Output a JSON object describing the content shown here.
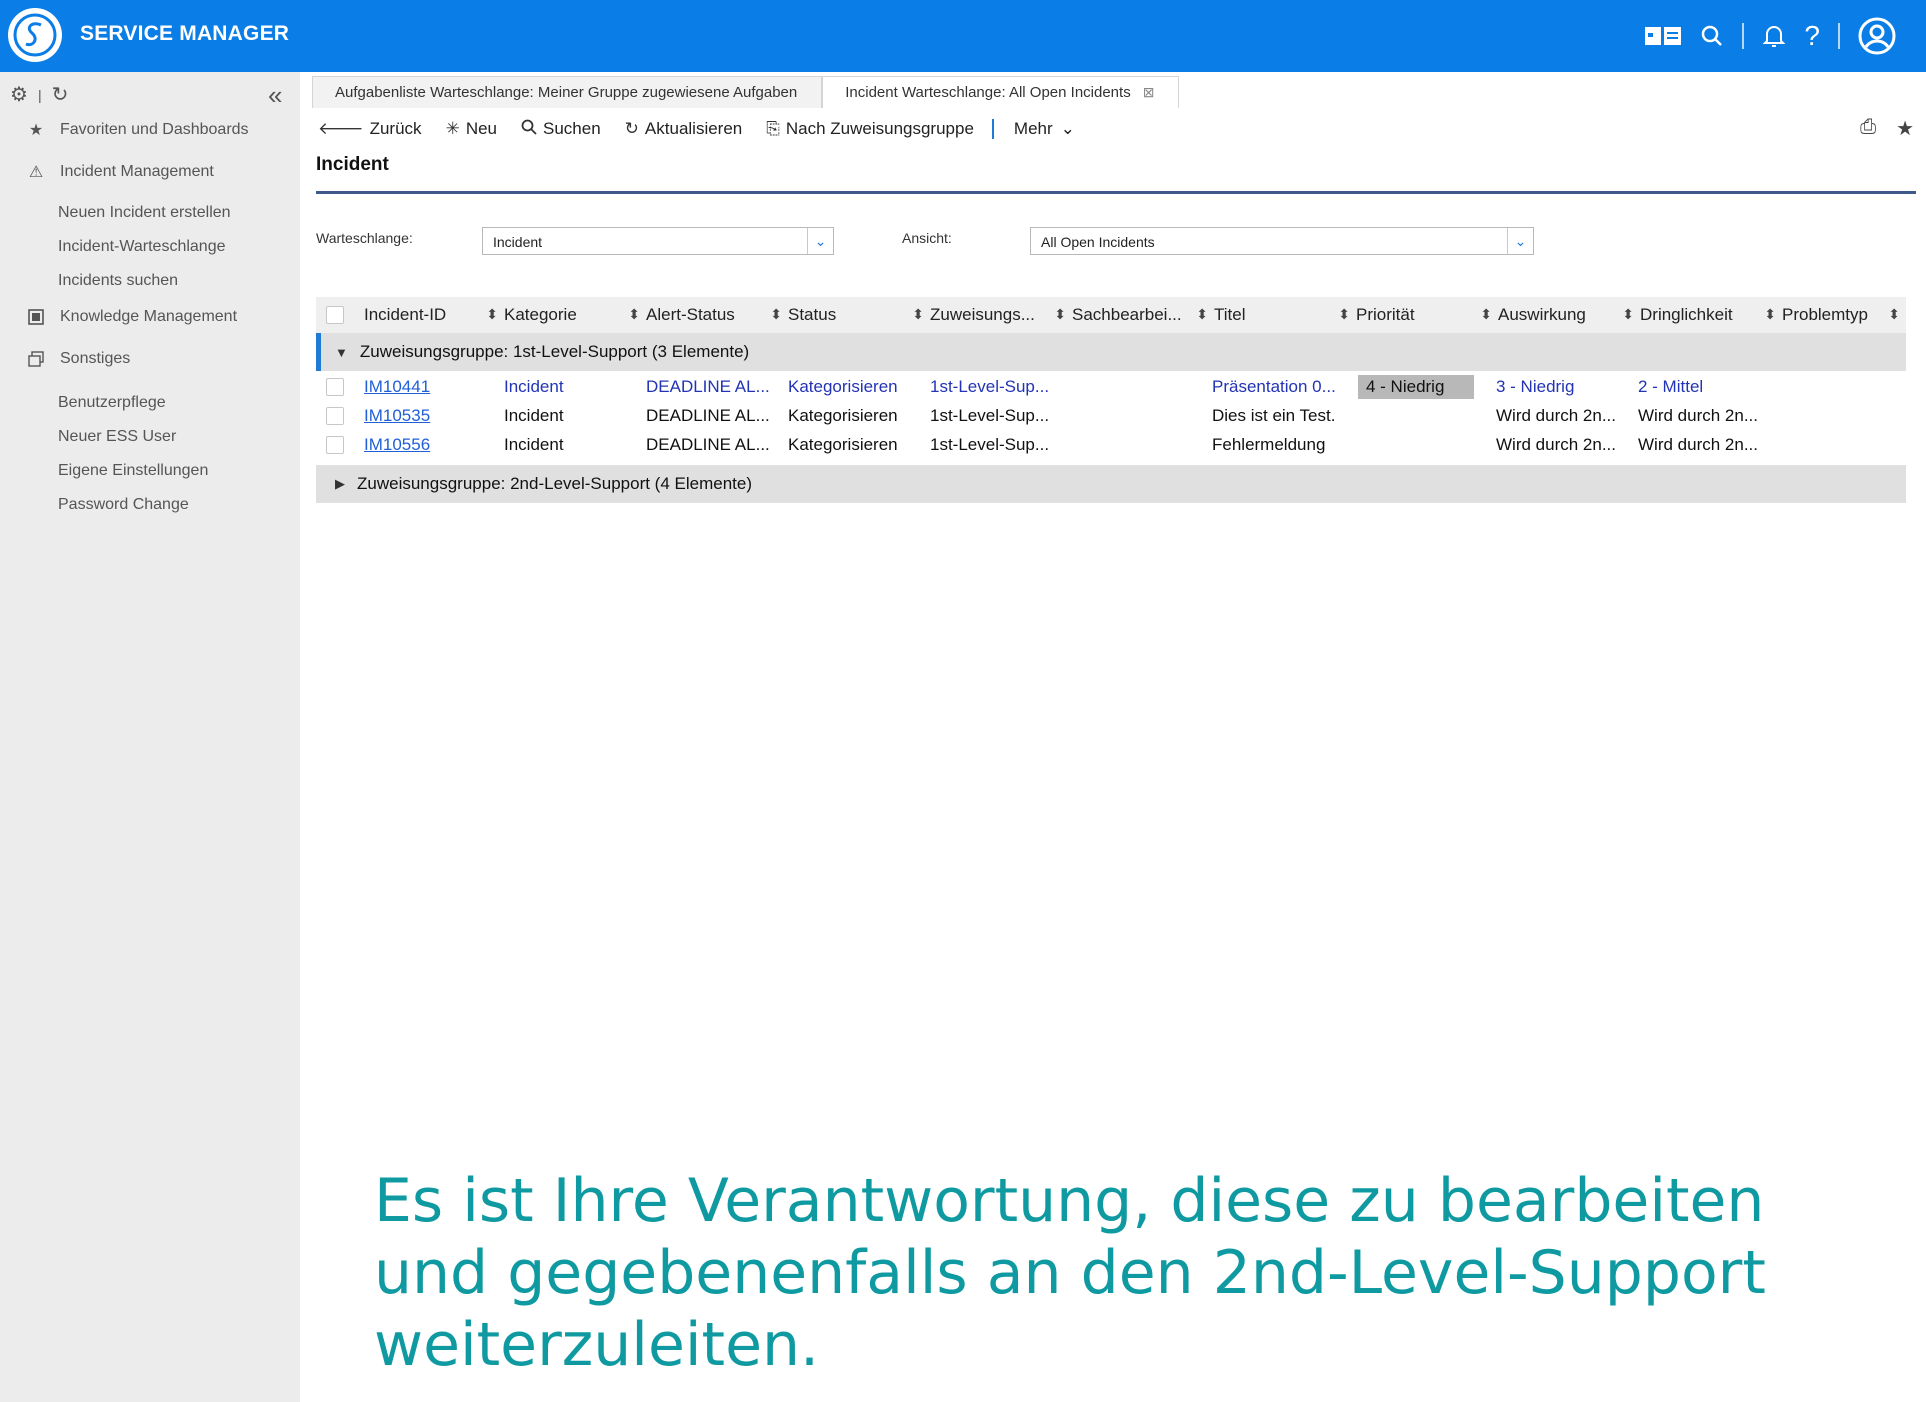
{
  "app": {
    "brand": "SERVICE MANAGER"
  },
  "sidebar": {
    "items": [
      {
        "label": "Favoriten und Dashboards",
        "icon": "star-icon"
      },
      {
        "label": "Incident Management",
        "icon": "warning-icon"
      },
      {
        "label": "Knowledge Management",
        "icon": "book-icon"
      },
      {
        "label": "Sonstiges",
        "icon": "copy-icon"
      }
    ],
    "incident_sub": [
      "Neuen Incident erstellen",
      "Incident-Warteschlange",
      "Incidents suchen"
    ],
    "other_sub": [
      "Benutzerpflege",
      "Neuer ESS User",
      "Eigene Einstellungen",
      "Password Change"
    ]
  },
  "tabs": [
    {
      "label": "Aufgabenliste Warteschlange: Meiner Gruppe zugewiesene Aufgaben",
      "active": false
    },
    {
      "label": "Incident Warteschlange: All Open Incidents",
      "active": true
    }
  ],
  "toolbar": {
    "back": "Zurück",
    "new": "Neu",
    "search": "Suchen",
    "refresh": "Aktualisieren",
    "group_by": "Nach Zuweisungsgruppe",
    "more": "Mehr"
  },
  "page_title": "Incident",
  "filters": {
    "queue_label": "Warteschlange:",
    "queue_value": "Incident",
    "view_label": "Ansicht:",
    "view_value": "All Open Incidents"
  },
  "columns": [
    "Incident-ID",
    "Kategorie",
    "Alert-Status",
    "Status",
    "Zuweisungs...",
    "Sachbearbei...",
    "Titel",
    "Priorität",
    "Auswirkung",
    "Dringlichkeit",
    "Problemtyp"
  ],
  "groups": [
    {
      "label": "Zuweisungsgruppe: 1st-Level-Support (3 Elemente)",
      "rows": [
        {
          "id": "IM10441",
          "kategorie": "Incident",
          "alert": "DEADLINE AL...",
          "status": "Kategorisieren",
          "zuweisung": "1st-Level-Sup...",
          "sachbearbeiter": "",
          "titel": "Präsentation 0...",
          "prioritaet": "4 - Niedrig",
          "auswirkung": "3 - Niedrig",
          "dringlichkeit": "2 - Mittel",
          "problemtyp": ""
        },
        {
          "id": "IM10535",
          "kategorie": "Incident",
          "alert": "DEADLINE AL...",
          "status": "Kategorisieren",
          "zuweisung": "1st-Level-Sup...",
          "sachbearbeiter": "",
          "titel": "Dies ist ein Test.",
          "prioritaet": "",
          "auswirkung": "Wird durch 2n...",
          "dringlichkeit": "Wird durch 2n...",
          "problemtyp": ""
        },
        {
          "id": "IM10556",
          "kategorie": "Incident",
          "alert": "DEADLINE AL...",
          "status": "Kategorisieren",
          "zuweisung": "1st-Level-Sup...",
          "sachbearbeiter": "",
          "titel": "Fehlermeldung",
          "prioritaet": "",
          "auswirkung": "Wird durch 2n...",
          "dringlichkeit": "Wird durch 2n...",
          "problemtyp": ""
        }
      ]
    },
    {
      "label": "Zuweisungsgruppe: 2nd-Level-Support (4 Elemente)",
      "rows": []
    }
  ],
  "caption": "Es ist Ihre Verantwortung, diese zu bearbeiten und gegebenenfalls an den 2nd-Level-Support weiterzuleiten.",
  "colors": {
    "topbar": "#0a7ee6",
    "accent": "#1f7bd6",
    "caption": "#0f9aa1",
    "link": "#1f5fd8"
  }
}
